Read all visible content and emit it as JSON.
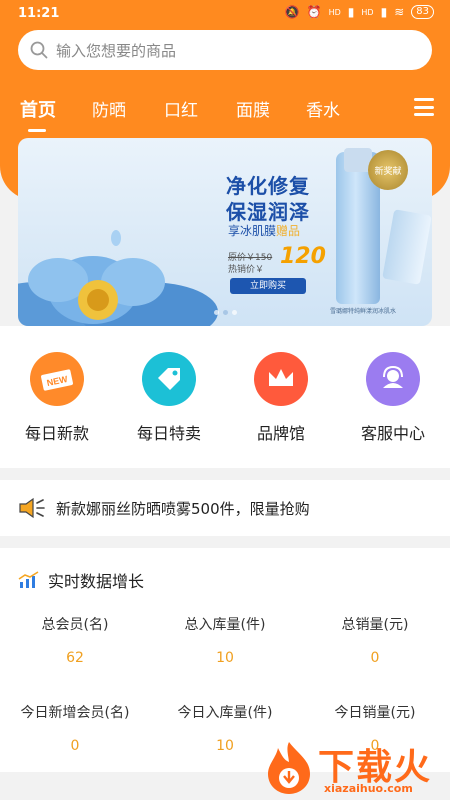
{
  "status_bar": {
    "time": "11:21",
    "signal1": "HD",
    "signal2": "HD",
    "battery": "83"
  },
  "search": {
    "placeholder": "输入您想要的商品"
  },
  "tabs": [
    {
      "label": "首页",
      "active": true
    },
    {
      "label": "防晒"
    },
    {
      "label": "口红"
    },
    {
      "label": "面膜"
    },
    {
      "label": "香水"
    }
  ],
  "banner": {
    "title_line1": "净化修复",
    "title_line2": "保湿润泽",
    "gift_prefix": "享冰肌膜",
    "gift_highlight": "赠品",
    "original_price": "原价￥150",
    "sale_label": "热销价￥",
    "sale_price": "120",
    "buy_button": "立即购买",
    "seal": "新奖献",
    "product_caption": "雪璐娜特纯鲜漾润冰肌水"
  },
  "categories": [
    {
      "label": "每日新款",
      "icon": "new-tag-icon",
      "color": "#ff8a2a"
    },
    {
      "label": "每日特卖",
      "icon": "price-tag-icon",
      "color": "#1cc0d6"
    },
    {
      "label": "品牌馆",
      "icon": "crown-icon",
      "color": "#ff5a3c"
    },
    {
      "label": "客服中心",
      "icon": "headset-icon",
      "color": "#9b7cf0"
    }
  ],
  "notice": {
    "text": "新款娜丽丝防晒喷雾500件，限量抢购",
    "icon": "speaker-icon"
  },
  "stats": {
    "title": "实时数据增长",
    "items": [
      {
        "label": "总会员(名)",
        "value": "62"
      },
      {
        "label": "总入库量(件)",
        "value": "10"
      },
      {
        "label": "总销量(元)",
        "value": "0"
      },
      {
        "label": "今日新增会员(名)",
        "value": "0"
      },
      {
        "label": "今日入库量(件)",
        "value": "10"
      },
      {
        "label": "今日销量(元)",
        "value": "0"
      }
    ]
  },
  "watermark": {
    "text": "下载火",
    "domain": "xiazaihuo.com"
  },
  "colors": {
    "brand": "#ff8a1f",
    "value": "#f0a020"
  }
}
